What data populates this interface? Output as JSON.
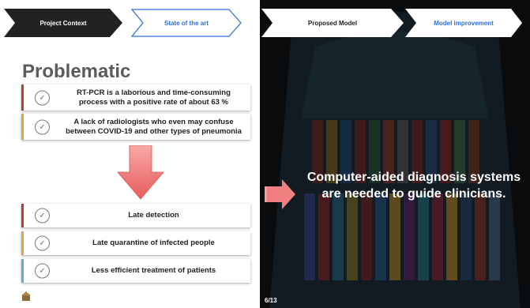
{
  "nav": {
    "items": [
      {
        "label": "Project Context"
      },
      {
        "label": "State of the art"
      },
      {
        "label": "Proposed Model"
      },
      {
        "label": "Model improvement"
      }
    ]
  },
  "section": {
    "title": "Problematic"
  },
  "problems": [
    {
      "text": "RT-PCR is a laborious and time-consuming process with a positive rate of about 63 %",
      "accent": "#c0392b"
    },
    {
      "text": "A lack of radiologists who even may confuse between COVID-19 and other types of pneumonia",
      "accent": "#e6a23c"
    }
  ],
  "consequences": [
    {
      "text": "Late detection",
      "accent": "#c0392b"
    },
    {
      "text": "Late quarantine of infected people",
      "accent": "#e6a23c"
    },
    {
      "text": "Less efficient treatment of patients",
      "accent": "#5dade2"
    }
  ],
  "right_panel": {
    "message": "Computer-aided diagnosis systems are needed to guide clinicians.",
    "page": "6/13"
  },
  "colors": {
    "nav_dark": "#222222",
    "nav_accent": "#2f6fd6",
    "arrow": "#f08080"
  },
  "icons": {
    "check": "check-circle-icon",
    "arrow_down": "arrow-down-icon",
    "arrow_right": "arrow-right-icon"
  }
}
